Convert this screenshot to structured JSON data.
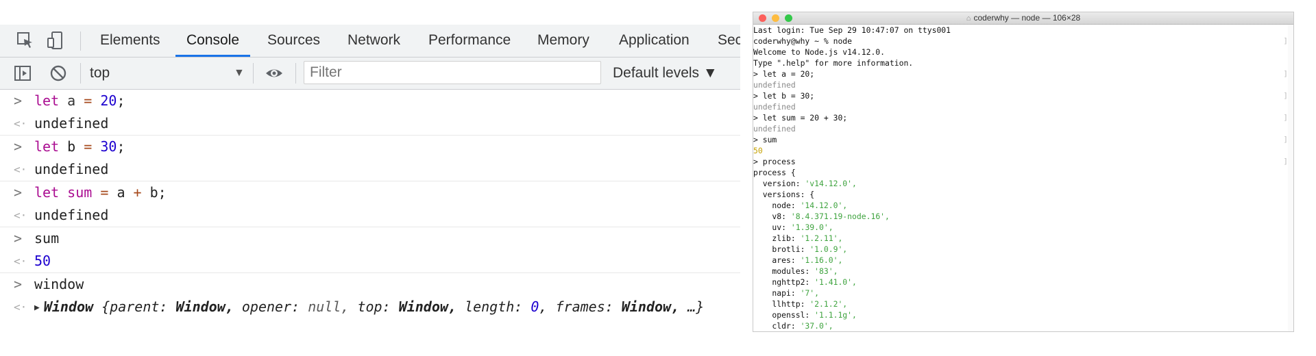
{
  "devtools": {
    "tabs": [
      "Elements",
      "Console",
      "Sources",
      "Network",
      "Performance",
      "Memory",
      "Application",
      "Sec"
    ],
    "active_tab": "Console",
    "context": "top",
    "filter_placeholder": "Filter",
    "levels": "Default levels ▼",
    "console": {
      "l1": {
        "kw": "let",
        "name": "a",
        "eq": "=",
        "num": "20",
        "semi": ";"
      },
      "r1": "undefined",
      "l2": {
        "kw": "let",
        "name": "b",
        "eq": "=",
        "num": "30",
        "semi": ";"
      },
      "r2": "undefined",
      "l3": {
        "kw": "let",
        "name": "sum",
        "eq": "=",
        "a": "a",
        "plus": "+",
        "b": "b;"
      },
      "r3": "undefined",
      "l4": "sum",
      "r4": "50",
      "l5": "window",
      "r5": {
        "name": "Window",
        "open": "{",
        "k1": "parent:",
        "v1": "Window,",
        "k2": "opener:",
        "v2": "null,",
        "k3": "top:",
        "v3": "Window,",
        "k4": "length:",
        "v4": "0",
        "k5": ", frames:",
        "v5": "Window,",
        "tail": "…}"
      }
    }
  },
  "terminal": {
    "title": "coderwhy — node — 106×28",
    "lines": [
      "Last login: Tue Sep 29 10:47:07 on ttys001",
      "coderwhy@why ~ % node",
      "Welcome to Node.js v14.12.0.",
      "Type \".help\" for more information.",
      "> let a = 20;",
      "undefined",
      "> let b = 30;",
      "undefined",
      "> let sum = 20 + 30;",
      "undefined",
      "> sum",
      "50",
      "> process",
      "process {",
      "  version: ",
      "  versions: {",
      "    node: ",
      "    v8: ",
      "    uv: ",
      "    zlib: ",
      "    brotli: ",
      "    ares: ",
      "    modules: ",
      "    nghttp2: ",
      "    napi: ",
      "    llhttp: ",
      "    openssl: ",
      "    cldr: "
    ],
    "values": {
      "version": "'v14.12.0',",
      "node": "'14.12.0',",
      "v8": "'8.4.371.19-node.16',",
      "uv": "'1.39.0',",
      "zlib": "'1.2.11',",
      "brotli": "'1.0.9',",
      "ares": "'1.16.0',",
      "modules": "'83',",
      "nghttp2": "'1.41.0',",
      "napi": "'7',",
      "llhttp": "'2.1.2',",
      "openssl": "'1.1.1g',",
      "cldr": "'37.0',"
    },
    "marker": "]"
  },
  "colors": {
    "keyword": "#aa0d91",
    "number": "#1c00cf",
    "operator": "#a6491c",
    "active_tab_underline": "#1a73e8",
    "terminal_string": "#3ea33e",
    "terminal_number": "#c4a000"
  }
}
